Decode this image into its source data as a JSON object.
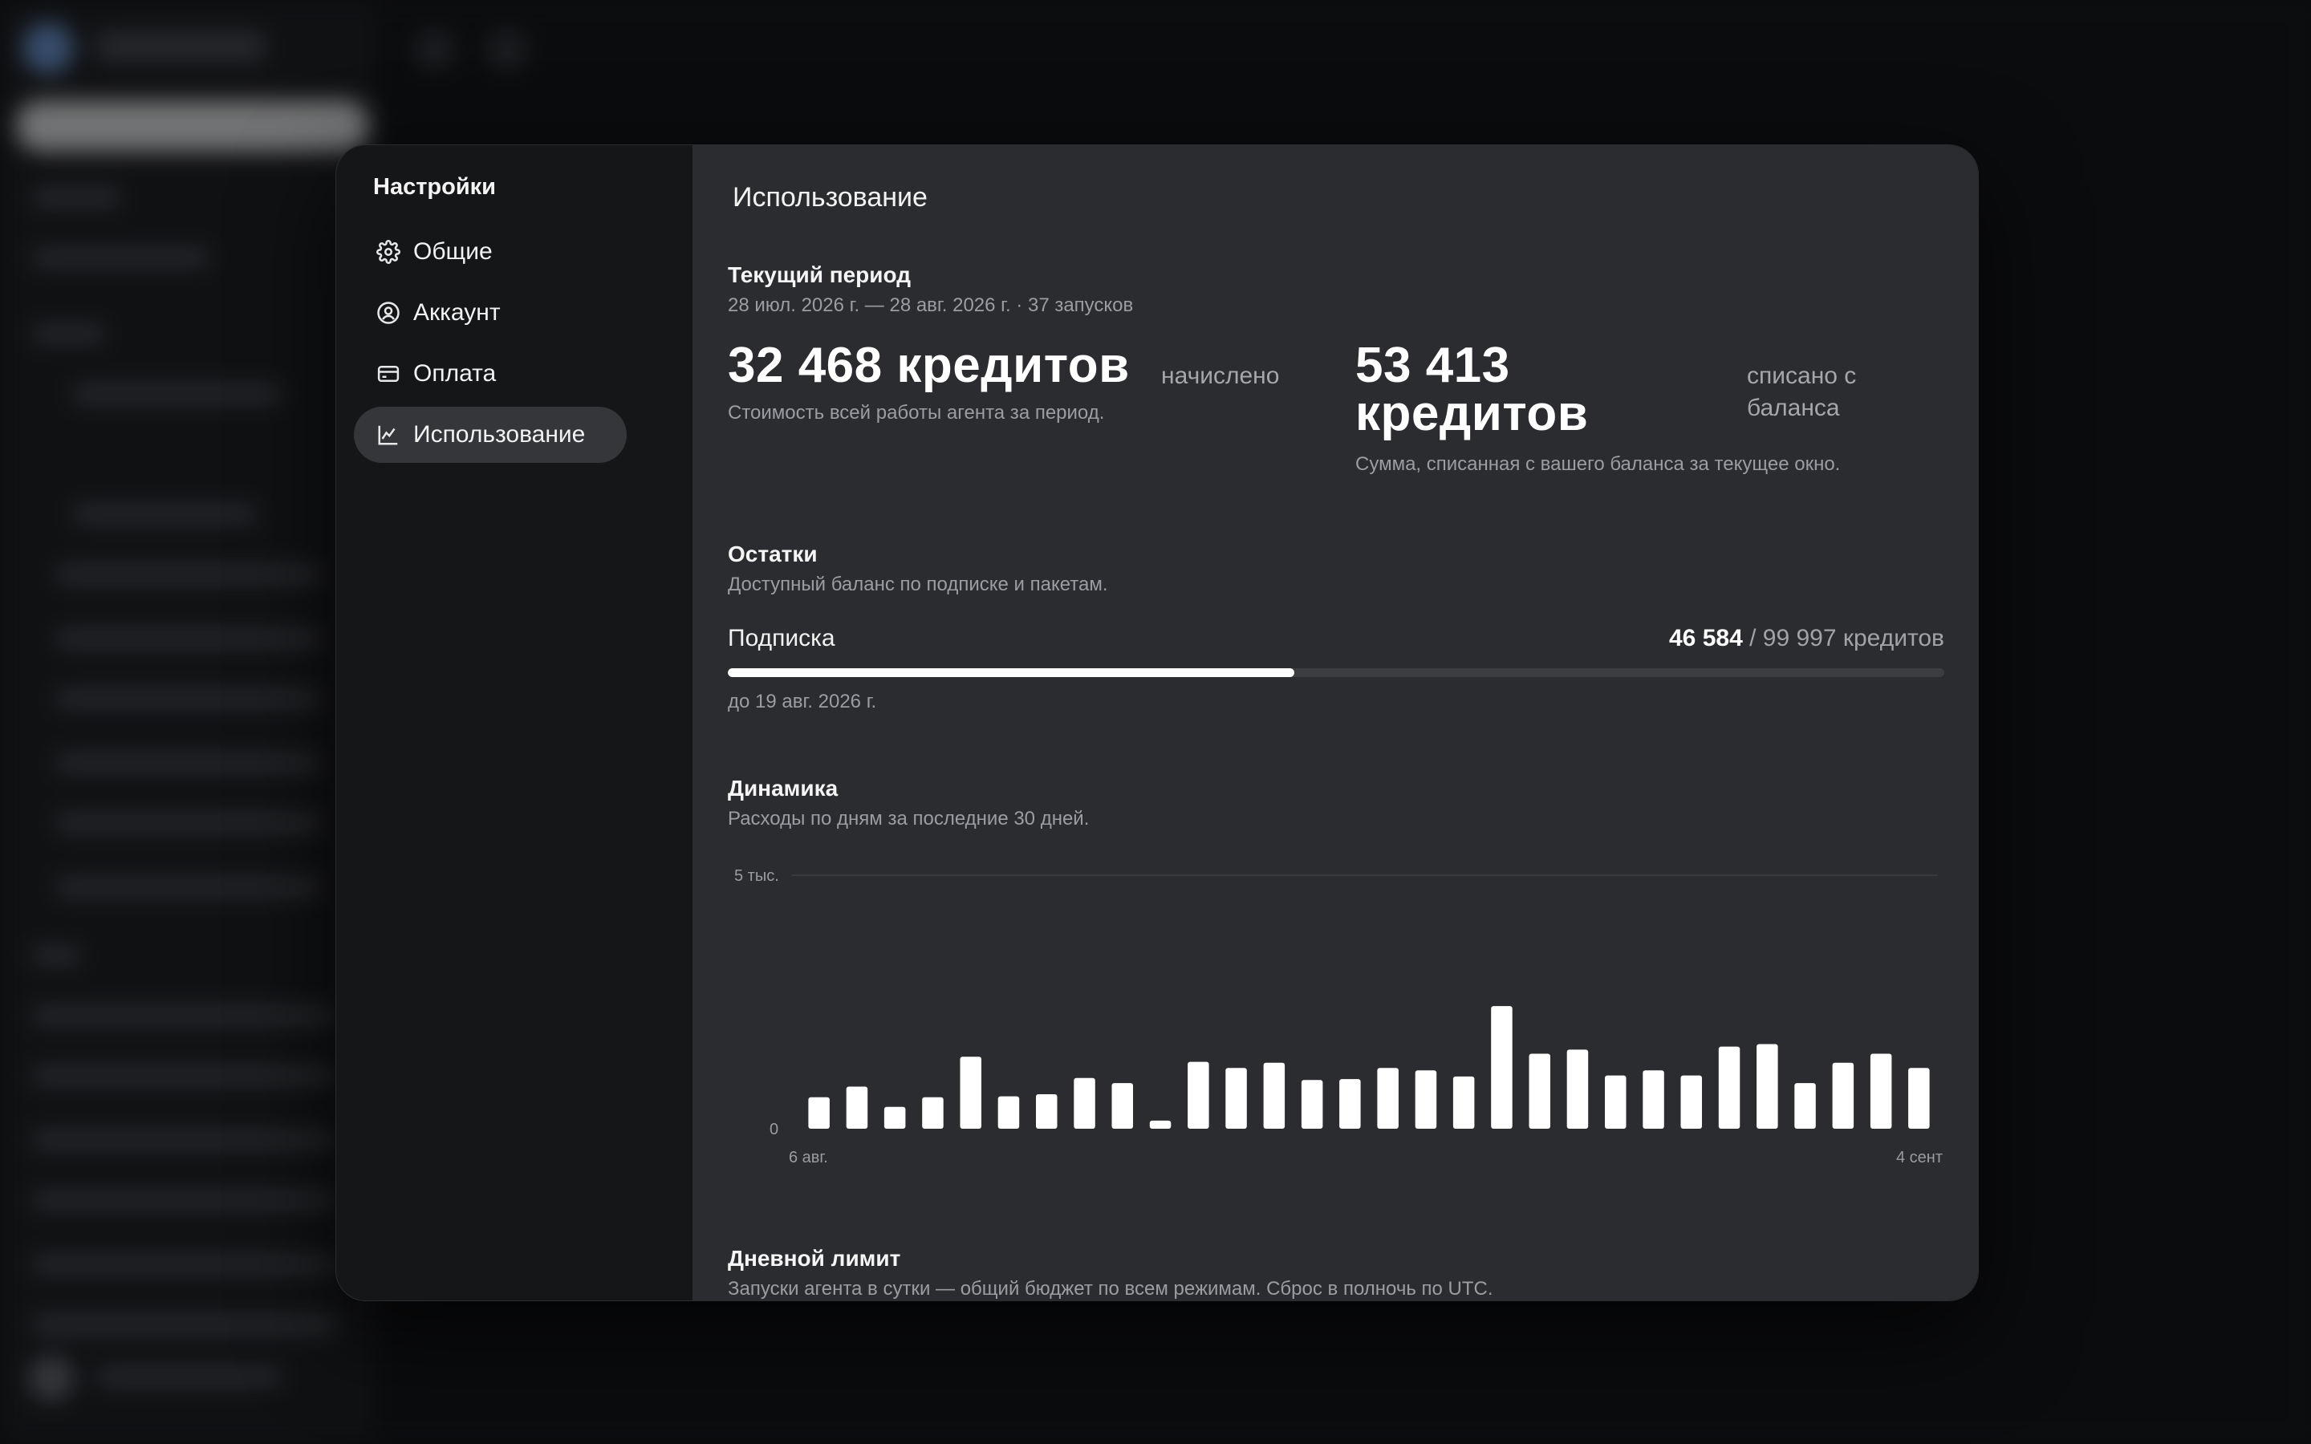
{
  "sidebar": {
    "title": "Настройки",
    "items": [
      {
        "label": "Общие",
        "icon": "gear-icon"
      },
      {
        "label": "Аккаунт",
        "icon": "user-circle-icon"
      },
      {
        "label": "Оплата",
        "icon": "card-icon"
      },
      {
        "label": "Использование",
        "icon": "chart-line-icon",
        "active": true
      }
    ]
  },
  "main": {
    "title": "Использование",
    "period": {
      "title": "Текущий период",
      "subtitle": "28 июл. 2026 г. — 28 авг. 2026 г. · 37 запусков",
      "accrued": {
        "value": "32 468 кредитов",
        "suffix": "начислено",
        "description": "Стоимость всей работы агента за период."
      },
      "charged": {
        "value_line1": "53 413",
        "value_line2": "кредитов",
        "suffix_line1": "списано с",
        "suffix_line2": "баланса",
        "description": "Сумма, списанная с вашего баланса за текущее окно."
      }
    },
    "balances": {
      "title": "Остатки",
      "subtitle": "Доступный баланс по подписке и пакетам.",
      "subscription": {
        "label": "Подписка",
        "used": "46 584",
        "total": "/ 99 997 кредитов",
        "progress_fraction": 0.466,
        "expires": "до 19 авг. 2026 г."
      }
    },
    "dynamics": {
      "title": "Динамика",
      "subtitle": "Расходы по дням за последние 30 дней."
    },
    "daily_limit": {
      "title": "Дневной лимит",
      "subtitle": "Запуски агента в сутки — общий бюджет по всем режимам. Сброс в полночь по UTC."
    }
  },
  "chart_data": {
    "type": "bar",
    "ylim": [
      0,
      5000
    ],
    "ytick_labels": [
      "0",
      "5 тыс."
    ],
    "xtick_labels": [
      "6 авг.",
      "4 сент"
    ],
    "grid": true,
    "values": [
      620,
      830,
      430,
      620,
      1420,
      640,
      680,
      1000,
      900,
      160,
      1320,
      1200,
      1300,
      960,
      980,
      1200,
      1150,
      1030,
      2420,
      1480,
      1560,
      1050,
      1150,
      1050,
      1620,
      1670,
      900,
      1300,
      1480,
      1200
    ],
    "bar_color": "#ffffff"
  }
}
